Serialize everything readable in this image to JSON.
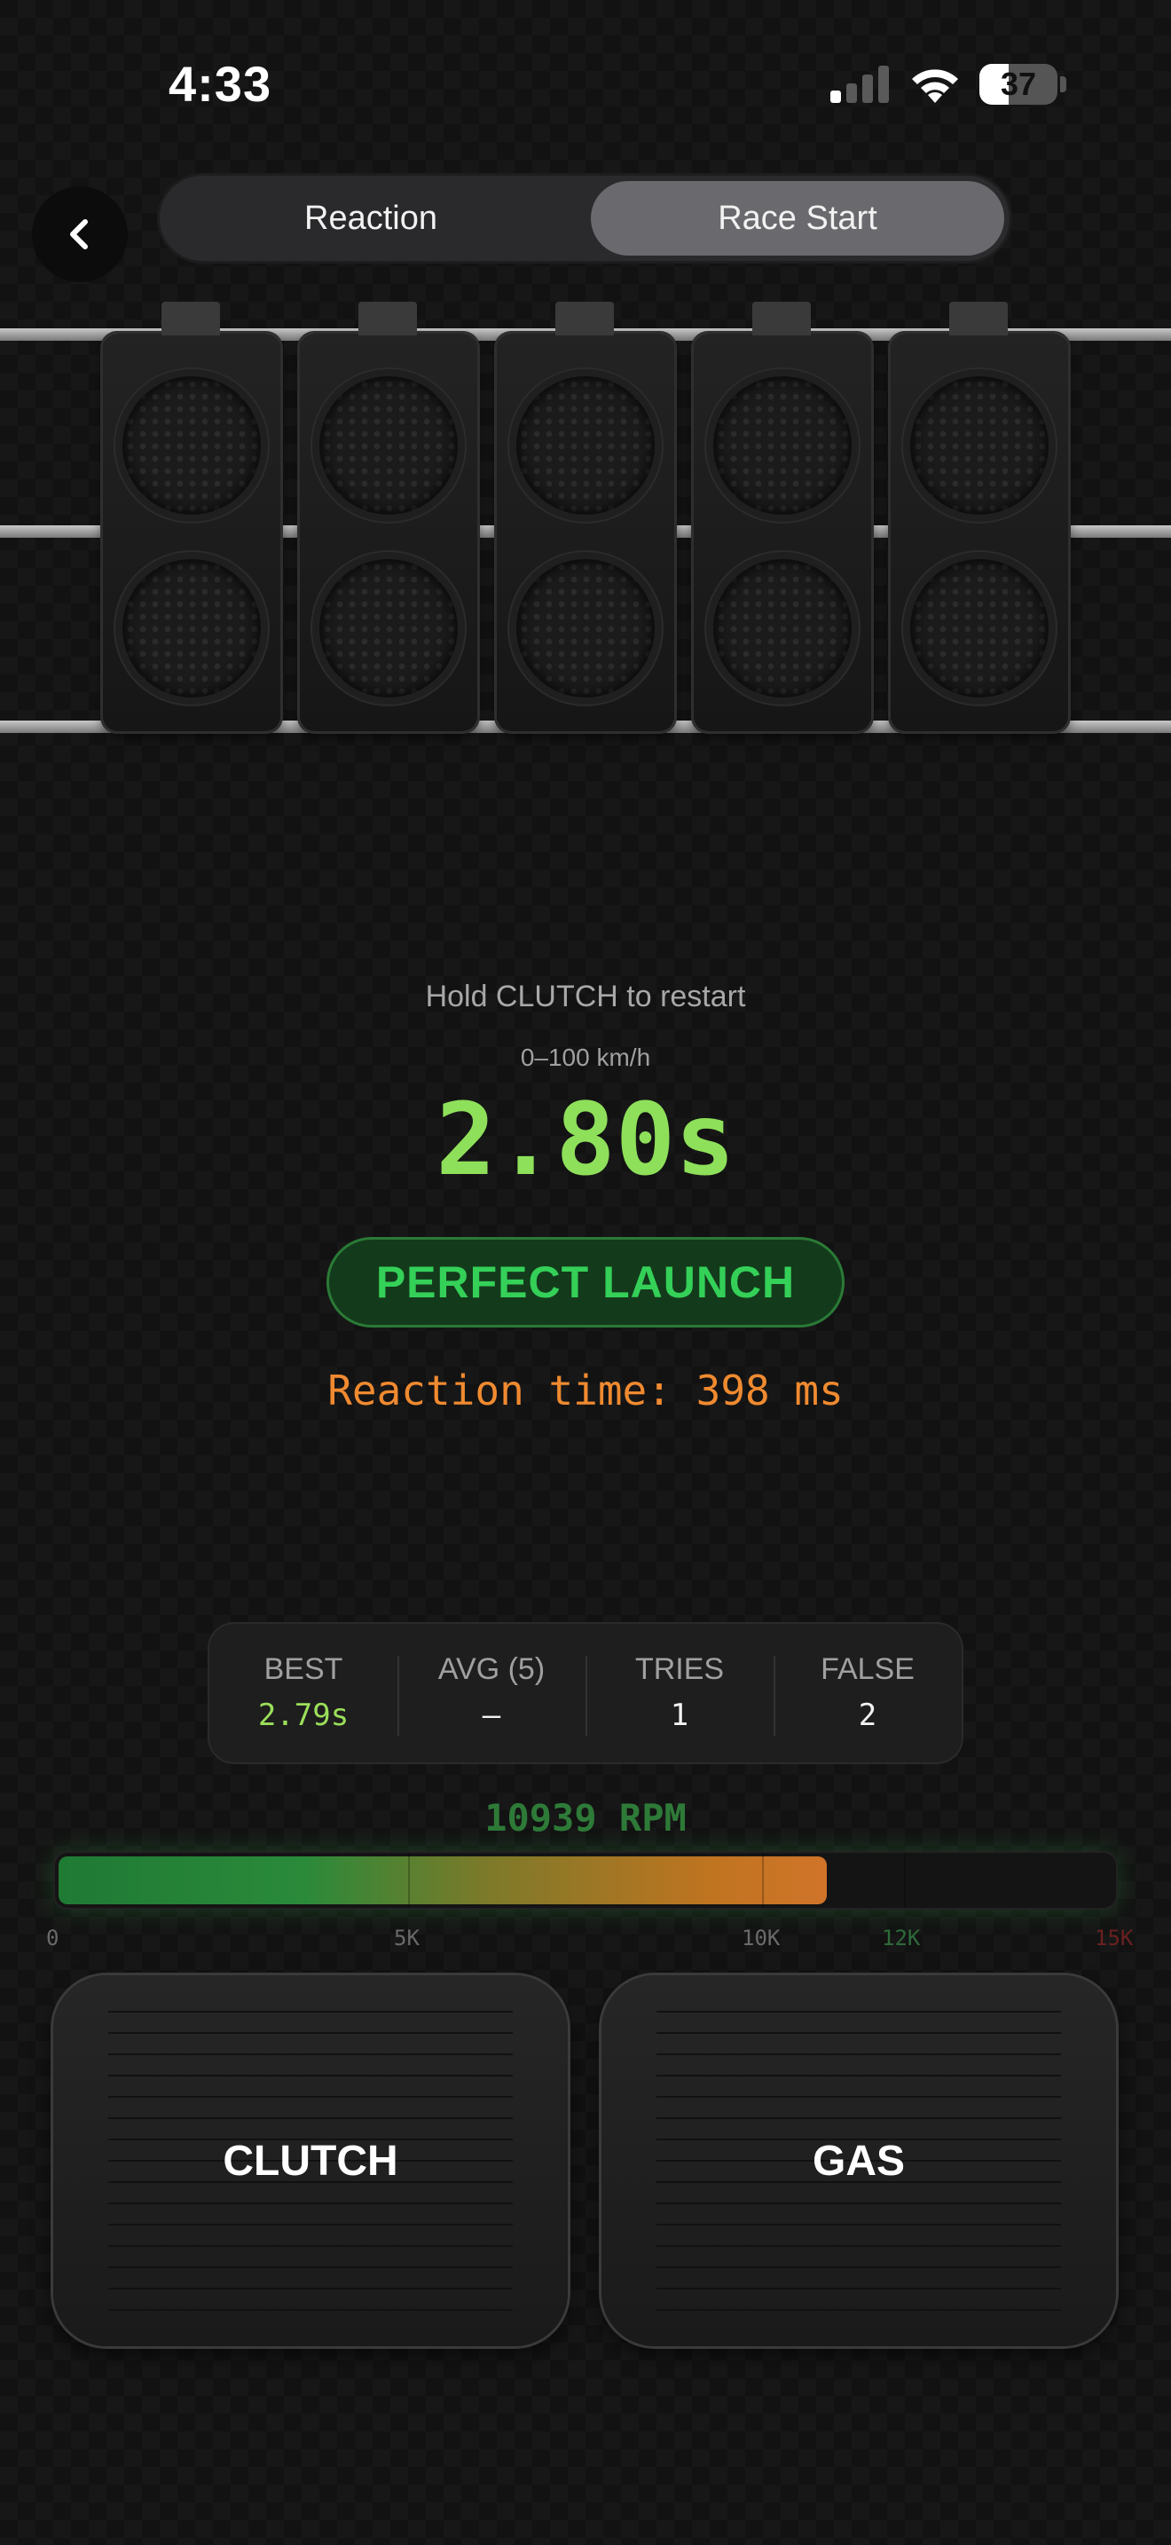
{
  "status": {
    "time": "4:33",
    "battery": "37"
  },
  "nav": {
    "tabs": [
      "Reaction",
      "Race Start"
    ],
    "active_tab": "Race Start"
  },
  "result": {
    "hint": "Hold CLUTCH to restart",
    "metric_label": "0–100 km/h",
    "time_value": "2.80s",
    "badge": "PERFECT LAUNCH",
    "reaction": "Reaction time: 398 ms"
  },
  "stats": [
    {
      "label": "BEST",
      "value": "2.79s"
    },
    {
      "label": "AVG (5)",
      "value": "–"
    },
    {
      "label": "TRIES",
      "value": "1"
    },
    {
      "label": "FALSE",
      "value": "2"
    }
  ],
  "rpm": {
    "label": "10939 RPM",
    "value": 10939,
    "max": 15000,
    "ticks": [
      "0",
      "5K",
      "10K",
      "12K",
      "15K"
    ],
    "colors": {
      "safe": "#6a6a6a",
      "shift": "#2e6a3a",
      "redline": "#6a2020"
    }
  },
  "pedals": {
    "left": "CLUTCH",
    "right": "GAS"
  },
  "lights": {
    "count": 5,
    "lit": 0
  }
}
